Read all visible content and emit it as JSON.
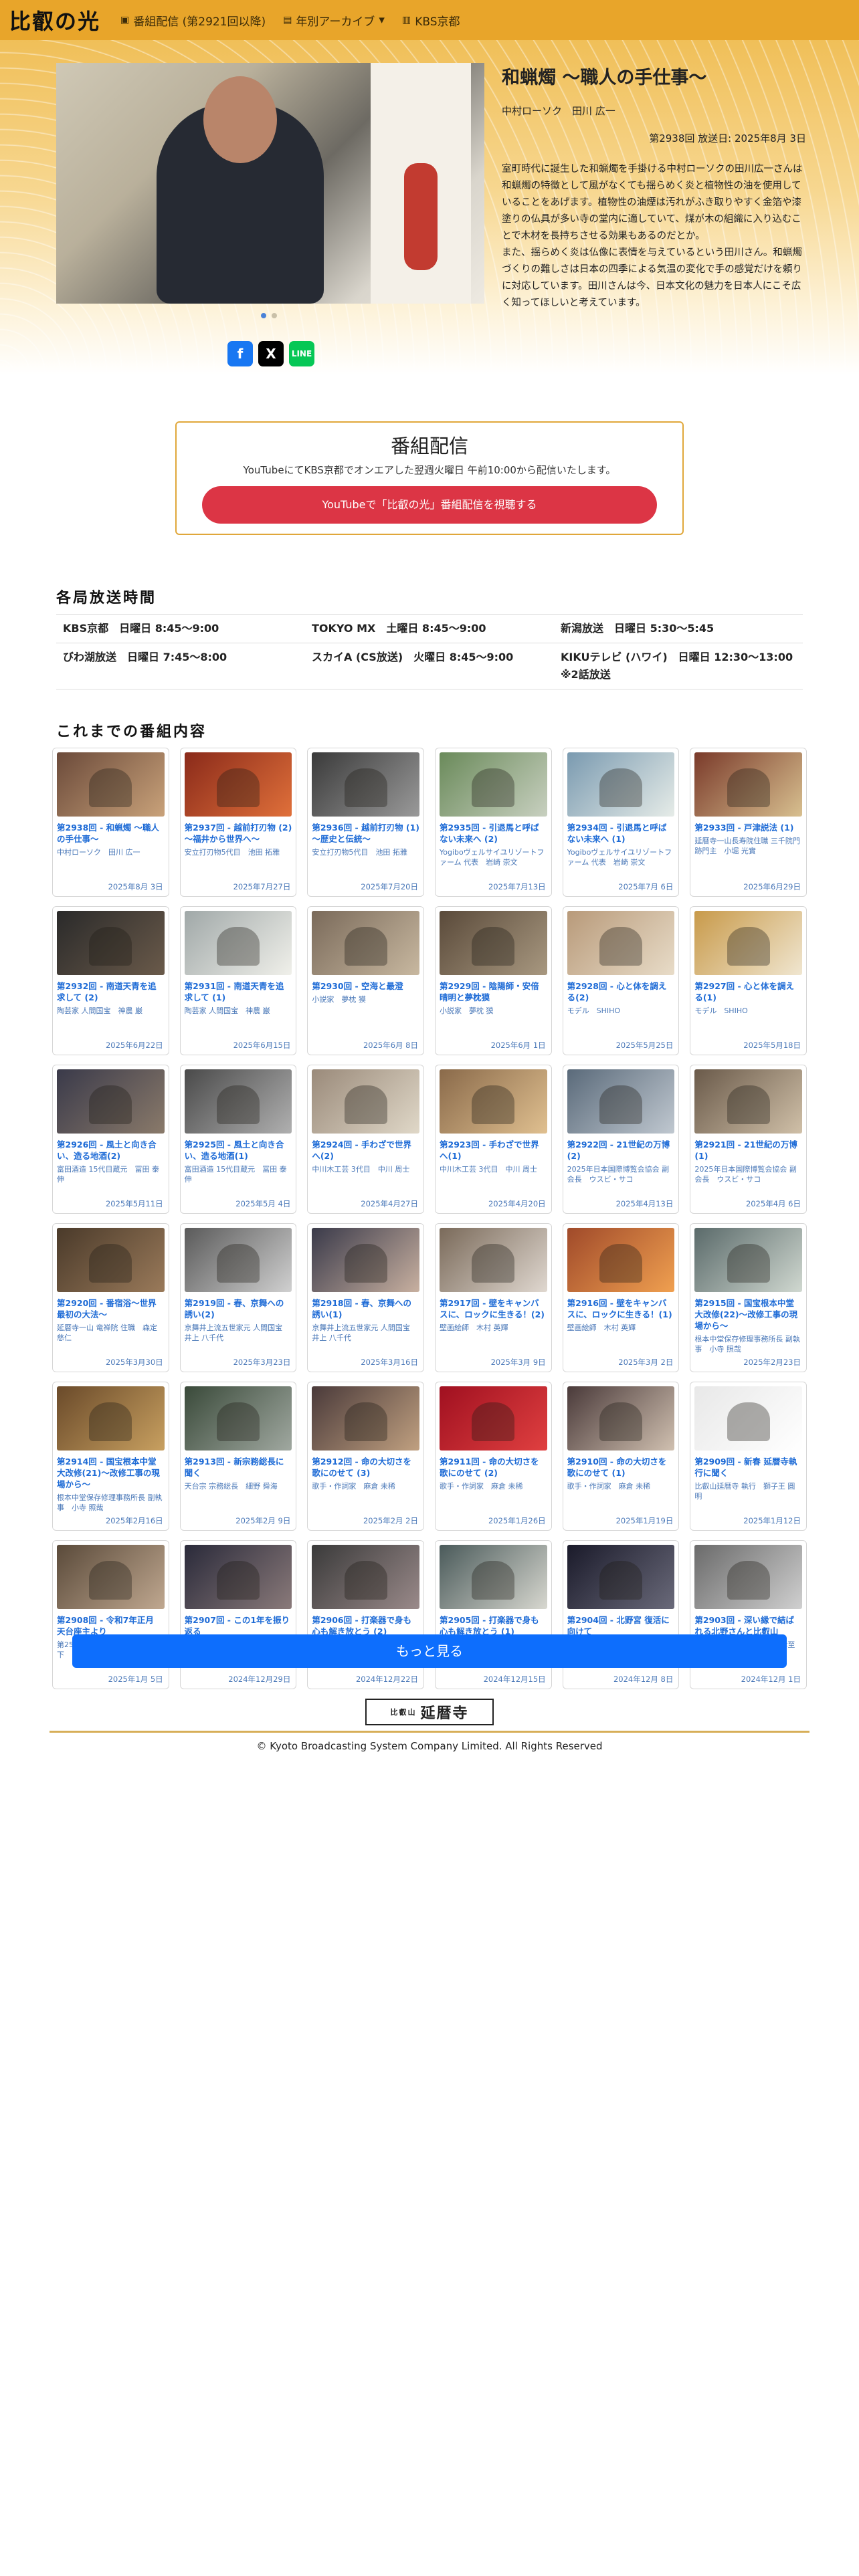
{
  "nav": {
    "brand": "比叡の光",
    "item1_icon": "calendar-icon",
    "item1": "番組配信 (第2921回以降)",
    "item2_icon": "archive-icon",
    "item2": "年別アーカイブ",
    "item2_caret": "▾",
    "item3_icon": "building-icon",
    "item3": "KBS京都"
  },
  "hero": {
    "title": "和蝋燭 ～職人の手仕事～",
    "subtitle": "中村ローソク　田川 広一",
    "date": "第2938回 放送日: 2025年8月 3日",
    "description": "室町時代に誕生した和蝋燭を手掛ける中村ローソクの田川広一さんは和蝋燭の特徴として風がなくても揺らめく炎と植物性の油を使用していることをあげます。植物性の油煙は汚れがふき取りやすく金箔や漆塗りの仏具が多い寺の堂内に適していて、煤が木の組織に入り込むことで木材を長持ちさせる効果もあるのだとか。\nまた、揺らめく炎は仏像に表情を与えているという田川さん。和蝋燭づくりの難しさは日本の四季による気温の変化で手の感覚だけを頼りに対応しています。田川さんは今、日本文化の魅力を日本人にこそ広く知ってほしいと考えています。",
    "share_x": "X",
    "share_line": "LINE",
    "share_fb": "f"
  },
  "live": {
    "title": "番組配信",
    "text": "YouTubeにてKBS京都でオンエアした翌週火曜日 午前10:00から配信いたします。",
    "button": "YouTubeで「比叡の光」番組配信を視聴する"
  },
  "schedule": {
    "title": "各局放送時間",
    "rows": [
      [
        "KBS京都　日曜日 8:45〜9:00",
        "TOKYO MX　土曜日 8:45〜9:00",
        "新潟放送　日曜日 5:30〜5:45"
      ],
      [
        "びわ湖放送　日曜日 7:45〜8:00",
        "スカイA (CS放送)　火曜日 8:45〜9:00",
        "KIKUテレビ (ハワイ)　日曜日 12:30〜13:00\n※2話放送"
      ]
    ]
  },
  "episodes_title": "これまでの番組内容",
  "episodes": [
    {
      "t": "第2938回 - 和蝋燭 〜職人の手仕事〜",
      "s": "中村ローソク　田川 広一",
      "d": "2025年8月 3日"
    },
    {
      "t": "第2937回 - 越前打刃物 (2) 〜福井から世界へ〜",
      "s": "安立打刃物5代目　池田 拓雅",
      "d": "2025年7月27日"
    },
    {
      "t": "第2936回 - 越前打刃物 (1) 〜歴史と伝統〜",
      "s": "安立打刃物5代目　池田 拓雅",
      "d": "2025年7月20日"
    },
    {
      "t": "第2935回 - 引退馬と呼ばない未来へ (2)",
      "s": "Yogiboヴェルサイユリゾートファーム 代表　岩崎 崇文",
      "d": "2025年7月13日"
    },
    {
      "t": "第2934回 - 引退馬と呼ばない未来へ (1)",
      "s": "Yogiboヴェルサイユリゾートファーム 代表　岩崎 崇文",
      "d": "2025年7月 6日"
    },
    {
      "t": "第2933回 - 戸津説法 (1)",
      "s": "延暦寺一山長寿院住職 三千院門跡門主　小堀 光實",
      "d": "2025年6月29日"
    },
    {
      "t": "第2932回 - 南道天青を追求して (2)",
      "s": "陶芸家 人間国宝　神農 巌",
      "d": "2025年6月22日"
    },
    {
      "t": "第2931回 - 南道天青を追求して (1)",
      "s": "陶芸家 人間国宝　神農 巌",
      "d": "2025年6月15日"
    },
    {
      "t": "第2930回 - 空海と最澄",
      "s": "小説家　夢枕 獏",
      "d": "2025年6月 8日"
    },
    {
      "t": "第2929回 - 陰陽師・安倍晴明と夢枕獏",
      "s": "小説家　夢枕 獏",
      "d": "2025年6月 1日"
    },
    {
      "t": "第2928回 - 心と体を調える(2)",
      "s": "モデル　SHIHO",
      "d": "2025年5月25日"
    },
    {
      "t": "第2927回 - 心と体を調える(1)",
      "s": "モデル　SHIHO",
      "d": "2025年5月18日"
    },
    {
      "t": "第2926回 - 風土と向き合い、造る地酒(2)",
      "s": "富田酒造 15代目蔵元　冨田 泰伸",
      "d": "2025年5月11日"
    },
    {
      "t": "第2925回 - 風土と向き合い、造る地酒(1)",
      "s": "富田酒造 15代目蔵元　冨田 泰伸",
      "d": "2025年5月 4日"
    },
    {
      "t": "第2924回 - 手わざで世界へ(2)",
      "s": "中川木工芸 3代目　中川 周士",
      "d": "2025年4月27日"
    },
    {
      "t": "第2923回 - 手わざで世界へ(1)",
      "s": "中川木工芸 3代目　中川 周士",
      "d": "2025年4月20日"
    },
    {
      "t": "第2922回 - 21世紀の万博(2)",
      "s": "2025年日本国際博覧会協会 副会長　ウスビ・サコ",
      "d": "2025年4月13日"
    },
    {
      "t": "第2921回 - 21世紀の万博(1)",
      "s": "2025年日本国際博覧会協会 副会長　ウスビ・サコ",
      "d": "2025年4月 6日"
    },
    {
      "t": "第2920回 - 番宿浴〜世界最初の大法〜",
      "s": "延暦寺一山 竜禅院 住職　森定 慈仁",
      "d": "2025年3月30日"
    },
    {
      "t": "第2919回 - 春、京舞への誘い(2)",
      "s": "京舞井上流五世家元 人間国宝　井上 八千代",
      "d": "2025年3月23日"
    },
    {
      "t": "第2918回 - 春、京舞への誘い(1)",
      "s": "京舞井上流五世家元 人間国宝　井上 八千代",
      "d": "2025年3月16日"
    },
    {
      "t": "第2917回 - 壁をキャンバスに、ロックに生きる！(2)",
      "s": "壁画絵師　木村 英輝",
      "d": "2025年3月 9日"
    },
    {
      "t": "第2916回 - 壁をキャンバスに、ロックに生きる！(1)",
      "s": "壁画絵師　木村 英輝",
      "d": "2025年3月 2日"
    },
    {
      "t": "第2915回 - 国宝根本中堂大改修(22)〜改修工事の現場から〜",
      "s": "根本中堂保存修理事務所長 副執事　小寺 照哉",
      "d": "2025年2月23日"
    },
    {
      "t": "第2914回 - 国宝根本中堂大改修(21)〜改修工事の現場から〜",
      "s": "根本中堂保存修理事務所長 副執事　小寺 照哉",
      "d": "2025年2月16日"
    },
    {
      "t": "第2913回 - 新宗務総長に聞く",
      "s": "天台宗 宗務総長　細野 舜海",
      "d": "2025年2月 9日"
    },
    {
      "t": "第2912回 - 命の大切さを歌にのせて (3)",
      "s": "歌手・作詞家　麻倉 未稀",
      "d": "2025年2月 2日"
    },
    {
      "t": "第2911回 - 命の大切さを歌にのせて (2)",
      "s": "歌手・作詞家　麻倉 未稀",
      "d": "2025年1月26日"
    },
    {
      "t": "第2910回 - 命の大切さを歌にのせて (1)",
      "s": "歌手・作詞家　麻倉 未稀",
      "d": "2025年1月19日"
    },
    {
      "t": "第2909回 - 新春 延暦寺執行に聞く",
      "s": "比叡山延暦寺 執行　獅子王 圓明",
      "d": "2025年1月12日"
    },
    {
      "t": "第2908回 - 令和7年正月 天台座主より",
      "s": "第258世天台座主　大樹 孝啓 猊下",
      "d": "2025年1月 5日"
    },
    {
      "t": "第2907回 - この1年を振り返る",
      "s": "比叡山延暦寺 執行　獅子王 圓明",
      "d": "2024年12月29日"
    },
    {
      "t": "第2906回 - 打楽器で身も心も解き放とう (2)",
      "s": "ドラマー　梶原 徹也",
      "d": "2024年12月22日"
    },
    {
      "t": "第2905回 - 打楽器で身も心も解き放とう (1)",
      "s": "ドラマー　梶原 徹也",
      "d": "2024年12月15日"
    },
    {
      "t": "第2904回 - 北野宮 復活に向けて",
      "s": "北野天満宮 権宮司　神原 孝至",
      "d": "2024年12月 8日"
    },
    {
      "t": "第2903回 - 深い縁で結ばれる北野さんと比叡山",
      "s": "北野天満宮 権宮司　神原 孝至",
      "d": "2024年12月 1日"
    }
  ],
  "more": "もっと見る",
  "sponsor": {
    "small": "比叡山",
    "name": "延暦寺"
  },
  "copyright": "© Kyoto Broadcasting System Company Limited. All Rights Reserved"
}
